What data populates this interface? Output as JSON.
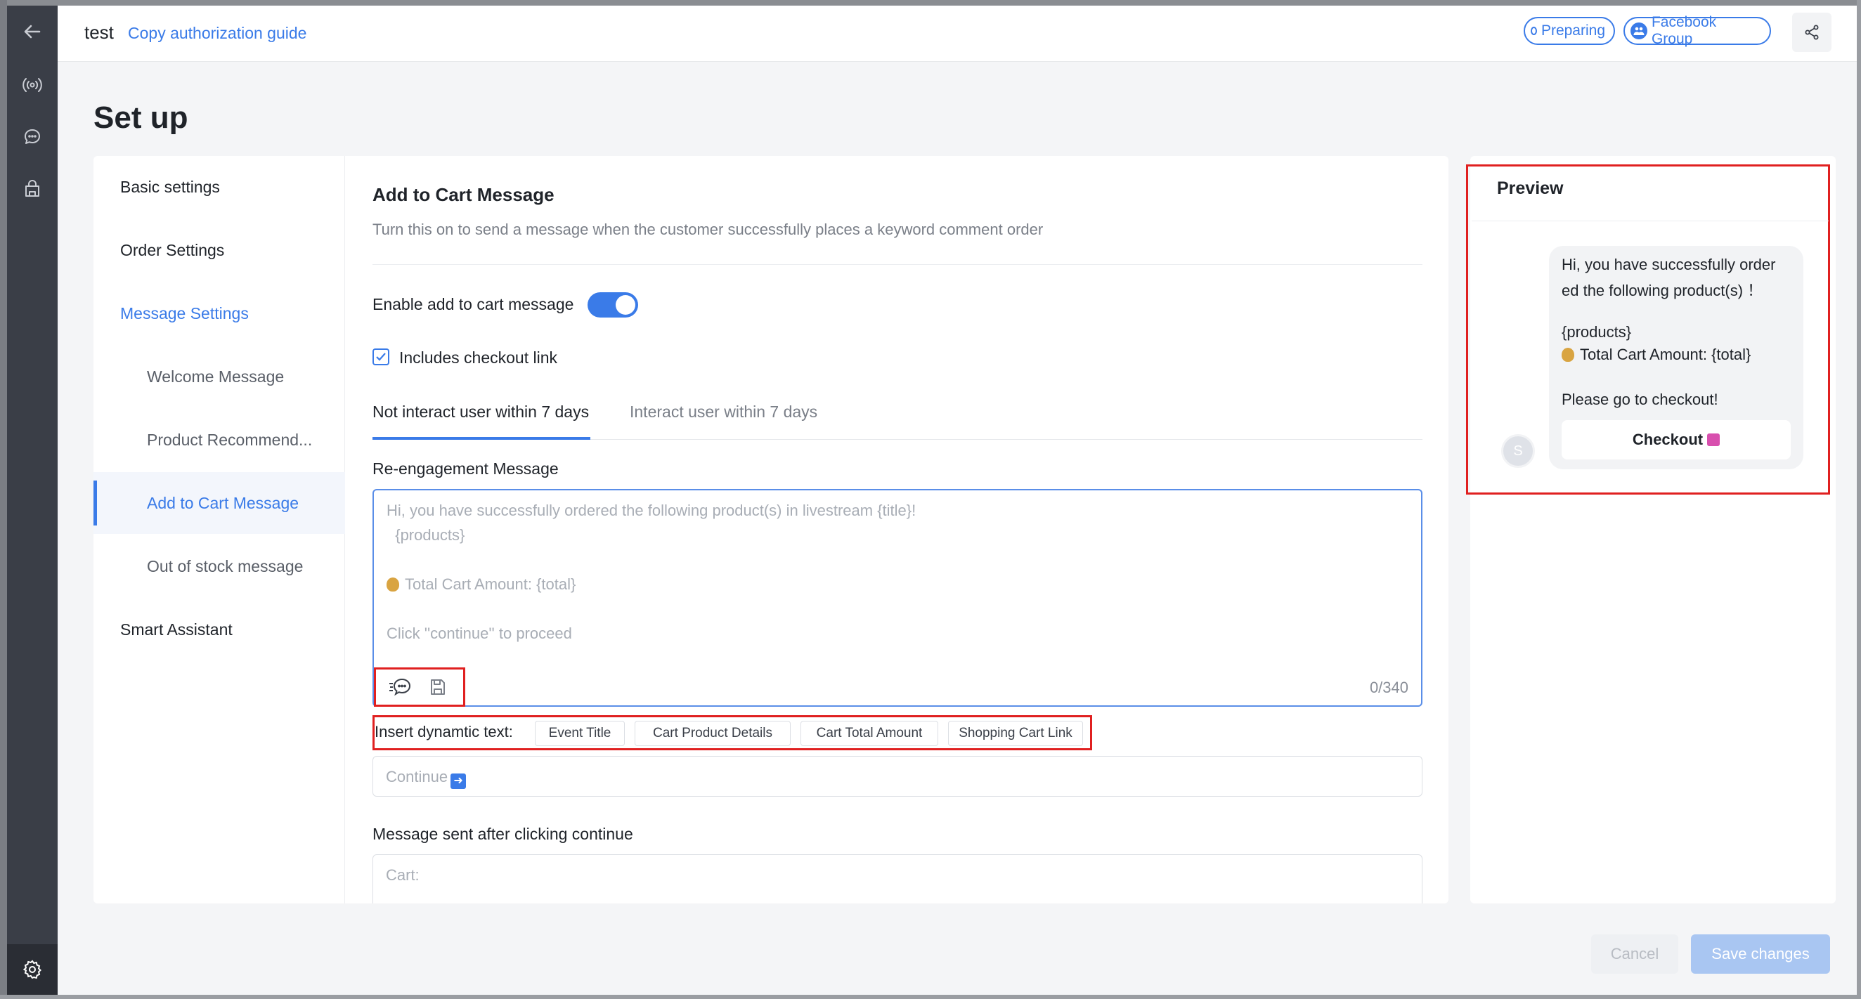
{
  "header": {
    "title": "test",
    "guide_link": "Copy authorization guide",
    "status_badge": "Preparing",
    "platform_badge": "Facebook Group"
  },
  "rail": {
    "icons": [
      "back-arrow-icon",
      "broadcast-icon",
      "chat-icon",
      "store-icon",
      "settings-icon"
    ]
  },
  "page": {
    "title": "Set up"
  },
  "menu": {
    "items": [
      {
        "label": "Basic settings"
      },
      {
        "label": "Order Settings"
      },
      {
        "label": "Message Settings"
      },
      {
        "label": "Welcome Message"
      },
      {
        "label": "Product Recommend..."
      },
      {
        "label": "Add to Cart Message"
      },
      {
        "label": "Out of stock message"
      },
      {
        "label": "Smart Assistant"
      }
    ]
  },
  "section": {
    "title": "Add to Cart Message",
    "description": "Turn this on to send a message when the customer successfully places a keyword comment order",
    "enable_label": "Enable add to cart message",
    "enable_on": true,
    "checkout_link_label": "Includes checkout link",
    "checkout_link_checked": true,
    "tabs": [
      "Not interact user within 7 days",
      "Interact user within 7 days"
    ],
    "reengagement_label": "Re-engagement Message",
    "textarea_lines": [
      "Hi, you have successfully ordered the following product(s) in livestream {title}!",
      "  {products}",
      "",
      "Total Cart Amount: {total}",
      "",
      "Click ''continue'' to proceed"
    ],
    "counter": "0/340",
    "dynamic_label": "Insert dynamtic text:",
    "dynamic_chips": [
      "Event Title",
      "Cart Product Details",
      "Cart Total Amount",
      "Shopping Cart Link"
    ],
    "continue_placeholder": "Continue",
    "after_continue_label": "Message sent after clicking continue",
    "after_continue_placeholder": "Cart:"
  },
  "preview": {
    "title": "Preview",
    "avatar_letter": "S",
    "lines": [
      "Hi, you have successfully order",
      "ed the following product(s) ！",
      "",
      "{products}",
      "Total Cart Amount: {total}",
      "",
      "Please go to checkout!"
    ],
    "checkout_button": "Checkout"
  },
  "footer": {
    "cancel": "Cancel",
    "save": "Save changes"
  },
  "colors": {
    "accent": "#3a7be8",
    "rail": "#3a3e47",
    "highlight_box": "#e02020"
  }
}
